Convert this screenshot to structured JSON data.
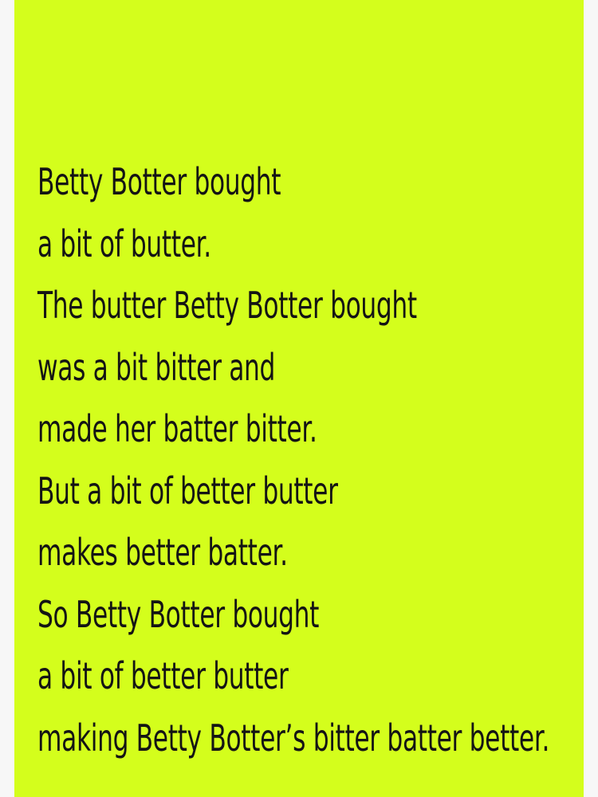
{
  "colors": {
    "background": "#f7f7f7",
    "card": "#d4fe1c",
    "text": "#141414"
  },
  "poem": {
    "lines": [
      "Betty Botter bought",
      "a bit of butter.",
      "The butter Betty Botter bought",
      "was a bit bitter and",
      "made her batter bitter.",
      "But a bit of better butter",
      "makes better batter.",
      "So Betty Botter bought",
      "a bit of better butter",
      "making Betty Botter’s bitter batter better."
    ]
  }
}
